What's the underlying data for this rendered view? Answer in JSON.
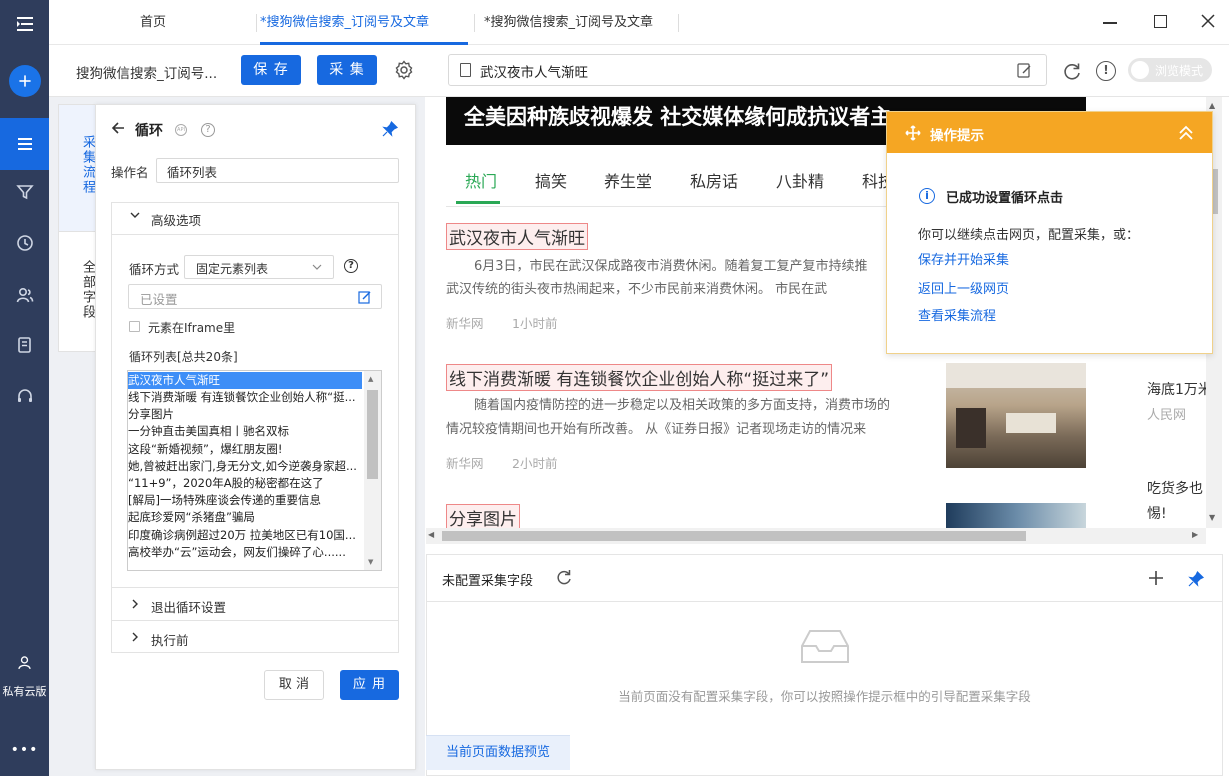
{
  "sidebar": {
    "user_label": "私有云版"
  },
  "titlebar": {
    "tabs": [
      {
        "label": "首页"
      },
      {
        "label": "*搜狗微信搜索_订阅号及文章"
      },
      {
        "label": "*搜狗微信搜索_订阅号及文章"
      }
    ]
  },
  "toolbar": {
    "task_name": "搜狗微信搜索_订阅号...",
    "save_label": "保 存",
    "collect_label": "采 集",
    "url": "武汉夜市人气渐旺",
    "browse_mode_label": "浏览模式"
  },
  "vtabs": {
    "flow": "采集流程",
    "fields": "全部字段"
  },
  "loop_panel": {
    "title": "循环",
    "op_name_label": "操作名",
    "op_name_value": "循环列表",
    "advanced_label": "高级选项",
    "loop_mode_label": "循环方式",
    "loop_mode_value": "固定元素列表",
    "set_value": "已设置",
    "iframe_label": "元素在Iframe里",
    "list_label": "循环列表[总共20条]",
    "list_items": [
      "武汉夜市人气渐旺",
      "线下消费渐暖 有连锁餐饮企业创始人称“挺...",
      "分享图片",
      "一分钟直击美国真相丨驰名双标",
      "这段“新婚视频”，爆红朋友圈!",
      "她,曾被赶出家门,身无分文,如今逆袭身家超...",
      "“11+9”，2020年A股的秘密都在这了",
      "[解局]一场特殊座谈会传递的重要信息",
      "起底珍爱网“杀猪盘”骗局",
      "印度确诊病例超过20万 拉美地区已有10国...",
      "高校举办“云”运动会，网友们操碎了心......"
    ],
    "exit_loop_label": "退出循环设置",
    "before_exec_label": "执行前",
    "cancel_label": "取 消",
    "apply_label": "应 用"
  },
  "page": {
    "banner": "全美因种族歧视爆发 社交媒体缘何成抗议者主",
    "nav": [
      "热门",
      "搞笑",
      "养生堂",
      "私房话",
      "八卦精",
      "科技"
    ],
    "news": [
      {
        "title": "武汉夜市人气渐旺",
        "line1": "6月3日，市民在武汉保成路夜市消费休闲。随着复工复产复市持续推",
        "line2": "武汉传统的街头夜市热闹起来，不少市民前来消费休闲。      市民在武",
        "source": "新华网",
        "time": "1小时前"
      },
      {
        "title": "线下消费渐暖 有连锁餐饮企业创始人称“挺过来了”",
        "line1": "随着国内疫情防控的进一步稳定以及相关政策的多方面支持，消费市场的",
        "line2": "情况较疫情期间也开始有所改善。      从《证券日报》记者现场走访的情况来",
        "source": "新华网",
        "time": "2小时前"
      },
      {
        "title": "分享图片"
      }
    ],
    "side1_title": "海底1万米",
    "side1_source": "人民网",
    "side2_line1": "吃货多也",
    "side2_line2": "惕!"
  },
  "hint": {
    "title": "操作提示",
    "success": "已成功设置循环点击",
    "desc": "你可以继续点击网页，配置采集，或：",
    "links": [
      "保存并开始采集",
      "返回上一级网页",
      "查看采集流程"
    ]
  },
  "fields_panel": {
    "title": "未配置采集字段",
    "empty_text": "当前页面没有配置采集字段，你可以按照操作提示框中的引导配置采集字段",
    "preview_tab": "当前页面数据预览"
  },
  "colors": {
    "accent": "#1769e0",
    "sidebar": "#2f3d5c",
    "hint": "#f5a623"
  }
}
